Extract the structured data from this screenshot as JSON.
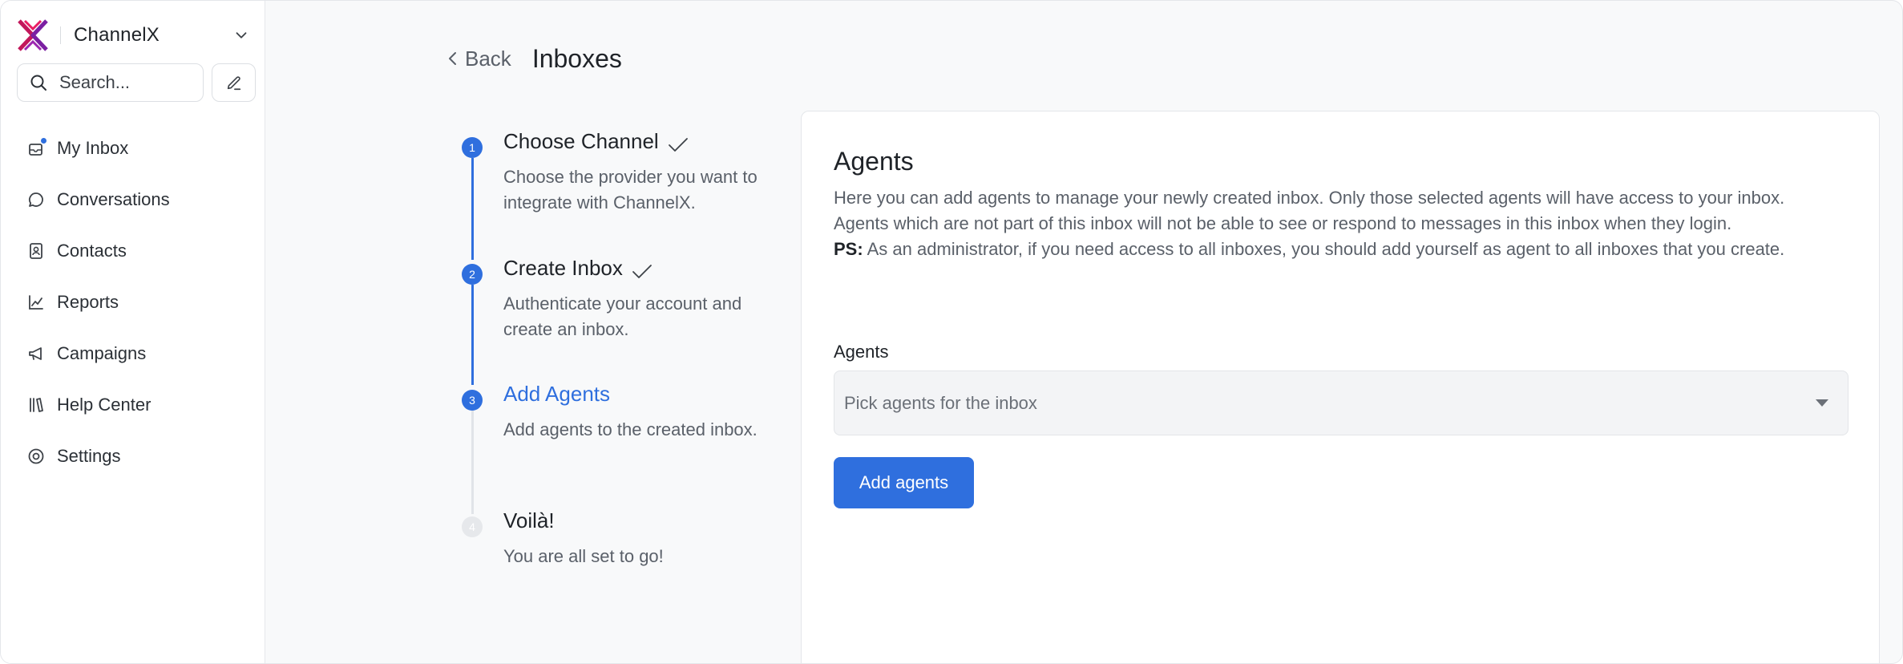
{
  "sidebar": {
    "brand": "ChannelX",
    "search_placeholder": "Search...",
    "items": [
      {
        "label": "My Inbox",
        "icon": "inbox-icon"
      },
      {
        "label": "Conversations",
        "icon": "chat-bubble-icon"
      },
      {
        "label": "Contacts",
        "icon": "contact-card-icon"
      },
      {
        "label": "Reports",
        "icon": "line-chart-icon"
      },
      {
        "label": "Campaigns",
        "icon": "megaphone-icon"
      },
      {
        "label": "Help Center",
        "icon": "library-icon"
      },
      {
        "label": "Settings",
        "icon": "settings-icon"
      }
    ]
  },
  "header": {
    "back_label": "Back",
    "title": "Inboxes"
  },
  "steps": [
    {
      "num": "1",
      "title": "Choose Channel",
      "desc": "Choose the provider you want to integrate with ChannelX.",
      "state": "done"
    },
    {
      "num": "2",
      "title": "Create Inbox",
      "desc": "Authenticate your account and create an inbox.",
      "state": "done"
    },
    {
      "num": "3",
      "title": "Add Agents",
      "desc": "Add agents to the created inbox.",
      "state": "active"
    },
    {
      "num": "4",
      "title": "Voilà!",
      "desc": "You are all set to go!",
      "state": "pending"
    }
  ],
  "card": {
    "title": "Agents",
    "description": "Here you can add agents to manage your newly created inbox. Only those selected agents will have access to your inbox. Agents which are not part of this inbox will not be able to see or respond to messages in this inbox when they login.",
    "ps_label": "PS:",
    "ps_text": " As an administrator, if you need access to all inboxes, you should add yourself as agent to all inboxes that you create.",
    "field_label": "Agents",
    "select_placeholder": "Pick agents for the inbox",
    "button_label": "Add agents"
  },
  "colors": {
    "accent": "#2f6fde",
    "logo_pink": "#c2185b",
    "logo_purple": "#6a1b9a"
  }
}
